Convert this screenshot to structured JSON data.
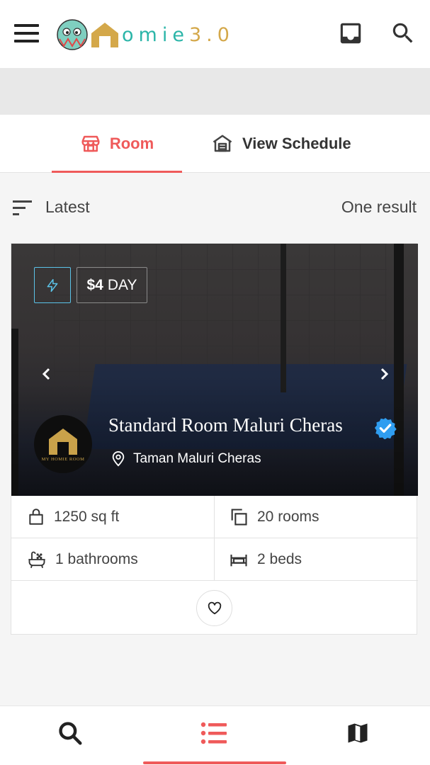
{
  "header": {
    "logo_part1": "omie",
    "logo_part2": "3.0",
    "menu_icon": "hamburger-menu-icon",
    "inbox_icon": "inbox-icon",
    "search_icon": "search-icon"
  },
  "tabs": [
    {
      "label": "Room",
      "icon": "storefront-icon",
      "active": true
    },
    {
      "label": "View Schedule",
      "icon": "warehouse-icon",
      "active": false
    }
  ],
  "filter": {
    "sort_label": "Latest",
    "result_count": "One result"
  },
  "listing": {
    "flash_icon": "lightning-icon",
    "price_amount": "$4",
    "price_unit": "DAY",
    "title": "Standard Room Maluri Cheras",
    "verified": true,
    "location": "Taman Maluri Cheras",
    "owner_logo_text": "MY HOMIE ROOM",
    "features": {
      "area": "1250 sq ft",
      "rooms": "20 rooms",
      "bathrooms": "1 bathrooms",
      "beds": "2 beds"
    }
  },
  "bottom_nav": [
    {
      "icon": "search-icon",
      "active": false
    },
    {
      "icon": "list-icon",
      "active": true
    },
    {
      "icon": "map-icon",
      "active": false
    }
  ],
  "colors": {
    "accent": "#ef5a5a",
    "logo_teal": "#2bb5a8",
    "logo_gold": "#d4a84a",
    "verified_blue": "#2f9df0",
    "flash_blue": "#5bc3e8"
  }
}
